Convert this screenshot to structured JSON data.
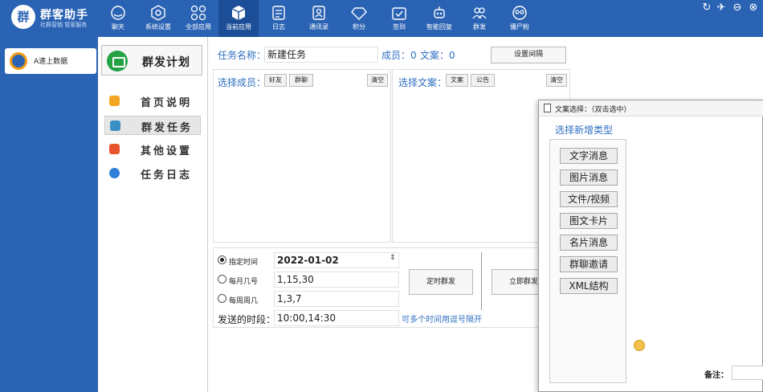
{
  "app": {
    "logo_char": "群",
    "title": "群客助手",
    "subtitle": "社群营销 管家服务"
  },
  "nav": [
    {
      "label": "聊天",
      "icon": "chat-icon"
    },
    {
      "label": "系统设置",
      "icon": "settings-icon"
    },
    {
      "label": "全部应用",
      "icon": "apps-icon"
    },
    {
      "label": "当前应用",
      "icon": "cube-icon"
    },
    {
      "label": "日志",
      "icon": "log-icon"
    },
    {
      "label": "通讯录",
      "icon": "contacts-icon"
    },
    {
      "label": "积分",
      "icon": "diamond-icon"
    },
    {
      "label": "签到",
      "icon": "checkin-icon"
    },
    {
      "label": "智能回复",
      "icon": "robot-icon"
    },
    {
      "label": "群发",
      "icon": "group-icon"
    },
    {
      "label": "僵尸粉",
      "icon": "zombie-icon"
    }
  ],
  "window_controls": [
    "↻",
    "✈",
    "⊖",
    "⊗"
  ],
  "account": {
    "label": "A速上数据"
  },
  "menu": {
    "title": "群发计划",
    "items": [
      {
        "label": "首页说明",
        "color": "#f2a623"
      },
      {
        "label": "群发任务",
        "color": "#3a8fc7"
      },
      {
        "label": "其他设置",
        "color": "#e8542c"
      },
      {
        "label": "任务日志",
        "color": "#2f7ed8"
      }
    ]
  },
  "task": {
    "name_label": "任务名称：",
    "name_value": "新建任务",
    "members_label": "成员：0",
    "copy_label": "文案：0",
    "interval_button": "设置间隔"
  },
  "select_members": {
    "label": "选择成员：",
    "btn_friends": "好友",
    "btn_groups": "群聊",
    "clear": "清空"
  },
  "select_copy": {
    "label": "选择文案：",
    "btn_copy": "文案",
    "btn_notice": "公告",
    "clear": "清空"
  },
  "schedule": {
    "opt_specific": "指定时间",
    "specific_value": "2022-01-02",
    "opt_monthly": "每月几号",
    "monthly_value": "1,15,30",
    "opt_weekly": "每周周几",
    "weekly_value": "1,3,7",
    "period_label": "发送的时段：",
    "period_value": "10:00,14:30",
    "hint": "可多个时间用逗号隔开",
    "timed_button": "定时群发",
    "now_button": "立即群发"
  },
  "popup": {
    "title": "文案选择：（双击选中）",
    "subtitle": "选择新增类型",
    "types": [
      "文字消息",
      "图片消息",
      "文件/视频",
      "图文卡片",
      "名片消息",
      "群聊邀请",
      "XML结构"
    ],
    "remark_label": "备注："
  }
}
